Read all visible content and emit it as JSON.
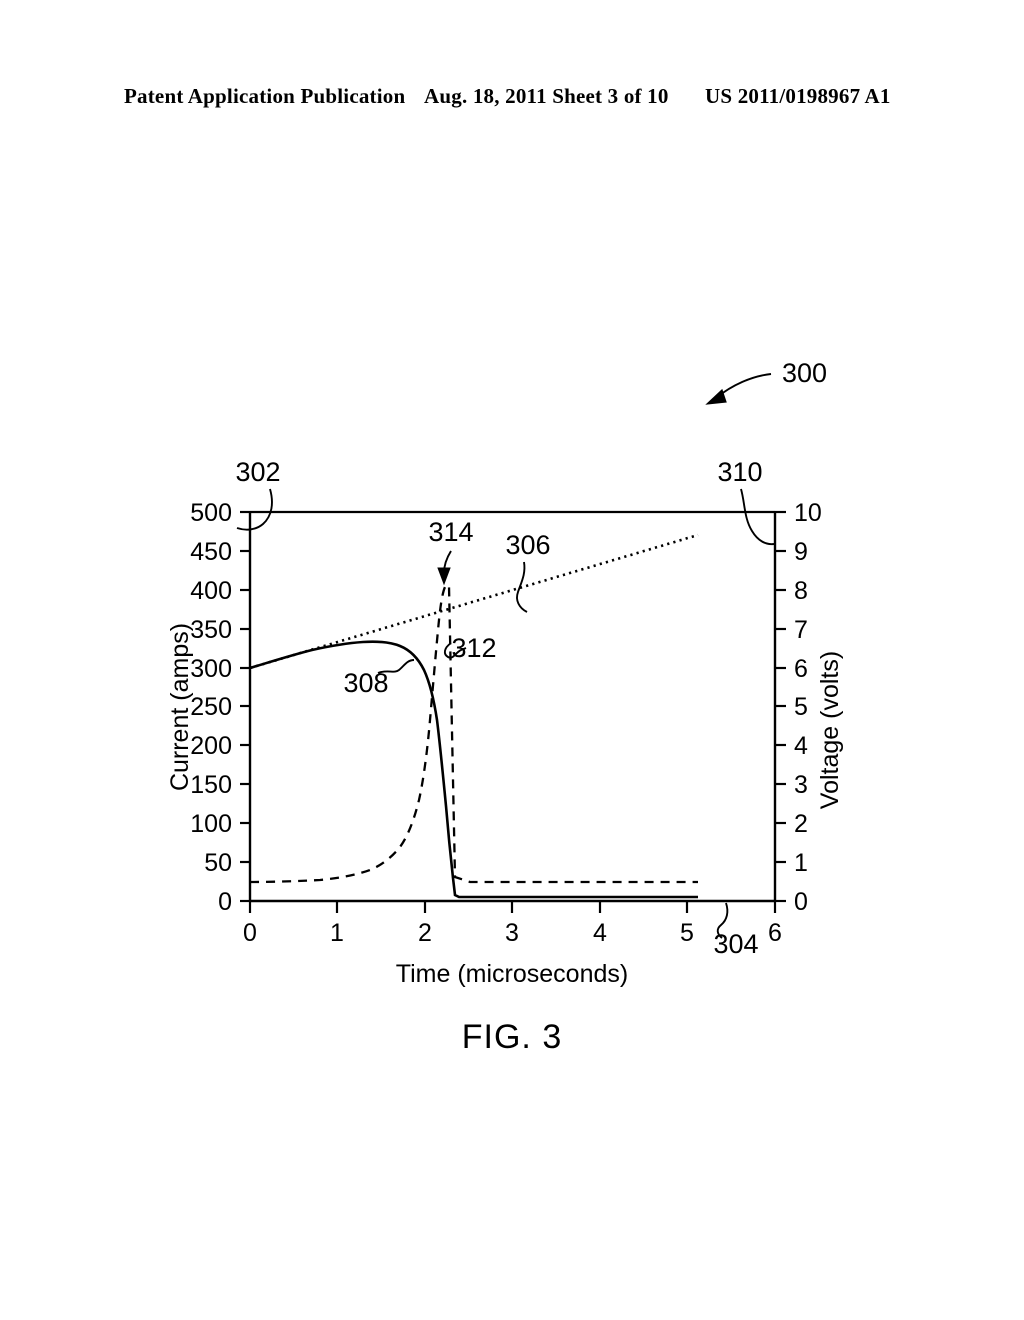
{
  "header": {
    "left": "Patent Application Publication",
    "middle": "Aug. 18, 2011  Sheet 3 of 10",
    "right": "US 2011/0198967 A1"
  },
  "caption": "FIG. 3",
  "reference_numerals": {
    "figure": "300",
    "left_axis": "302",
    "bottom_axis": "304",
    "voltage_trace": "306",
    "current_trace": "308",
    "right_axis": "310",
    "vertical_dashed": "312",
    "spike_peak": "314"
  },
  "chart_data": {
    "type": "line",
    "title": "FIG. 3",
    "xlabel": "Time (microseconds)",
    "ylabel": "Current (amps)",
    "y2label": "Voltage (volts)",
    "xlim": [
      0,
      6
    ],
    "ylim": [
      0,
      500
    ],
    "y2lim": [
      0,
      10
    ],
    "grid": false,
    "legend": "none",
    "xticks": [
      0,
      1,
      2,
      3,
      4,
      5,
      6
    ],
    "xticklabels": [
      "0",
      "1",
      "2",
      "3",
      "4",
      "5",
      "6"
    ],
    "yticks": [
      0,
      50,
      100,
      150,
      200,
      250,
      300,
      350,
      400,
      450,
      500
    ],
    "yticklabels": [
      "0",
      "50",
      "100",
      "150",
      "200",
      "250",
      "300",
      "350",
      "400",
      "450",
      "500"
    ],
    "y2ticks": [
      0,
      1,
      2,
      3,
      4,
      5,
      6,
      7,
      8,
      9,
      10
    ],
    "y2ticklabels": [
      "0",
      "1",
      "2",
      "3",
      "4",
      "5",
      "6",
      "7",
      "8",
      "9",
      "10"
    ],
    "series": [
      {
        "name": "308",
        "axis": "left",
        "style": "solid",
        "description": "Current trace: rises from 300 A, peaks near 335 A at 1.3 us, collapses to 0 A at 2.3 us",
        "x": [
          0,
          0.3,
          0.6,
          0.9,
          1.2,
          1.35,
          1.5,
          1.7,
          1.85,
          2.0,
          2.1,
          2.2,
          2.28,
          2.35,
          3.0,
          4.0,
          5.0
        ],
        "y": [
          300,
          312,
          322,
          330,
          335,
          335,
          332,
          322,
          306,
          275,
          235,
          150,
          60,
          4,
          4,
          4,
          4
        ]
      },
      {
        "name": "312",
        "axis": "left",
        "style": "dashed",
        "description": "Dashed current trace: flat near 25 A, rises steeply at 2.0 us, peaks at 415 A, drops vertically back to 25 A",
        "x": [
          0,
          0.4,
          0.8,
          1.1,
          1.35,
          1.55,
          1.7,
          1.8,
          1.9,
          1.97,
          2.02,
          2.06,
          2.1,
          2.15,
          2.2,
          2.26,
          2.32,
          2.34,
          2.6,
          3.5,
          4.5,
          5.0
        ],
        "y": [
          25,
          25,
          27,
          31,
          38,
          50,
          66,
          86,
          125,
          185,
          255,
          320,
          365,
          375,
          400,
          415,
          120,
          25,
          25,
          25,
          25,
          25
        ]
      },
      {
        "name": "306",
        "axis": "right",
        "style": "dotted",
        "description": "Voltage trace: near-linear rise from about 6.0 V to 9.4 V across 0 to 5 us",
        "x": [
          0,
          1,
          2,
          3,
          4,
          5
        ],
        "y": [
          6.0,
          6.7,
          7.4,
          8.1,
          8.8,
          9.4
        ]
      }
    ]
  }
}
